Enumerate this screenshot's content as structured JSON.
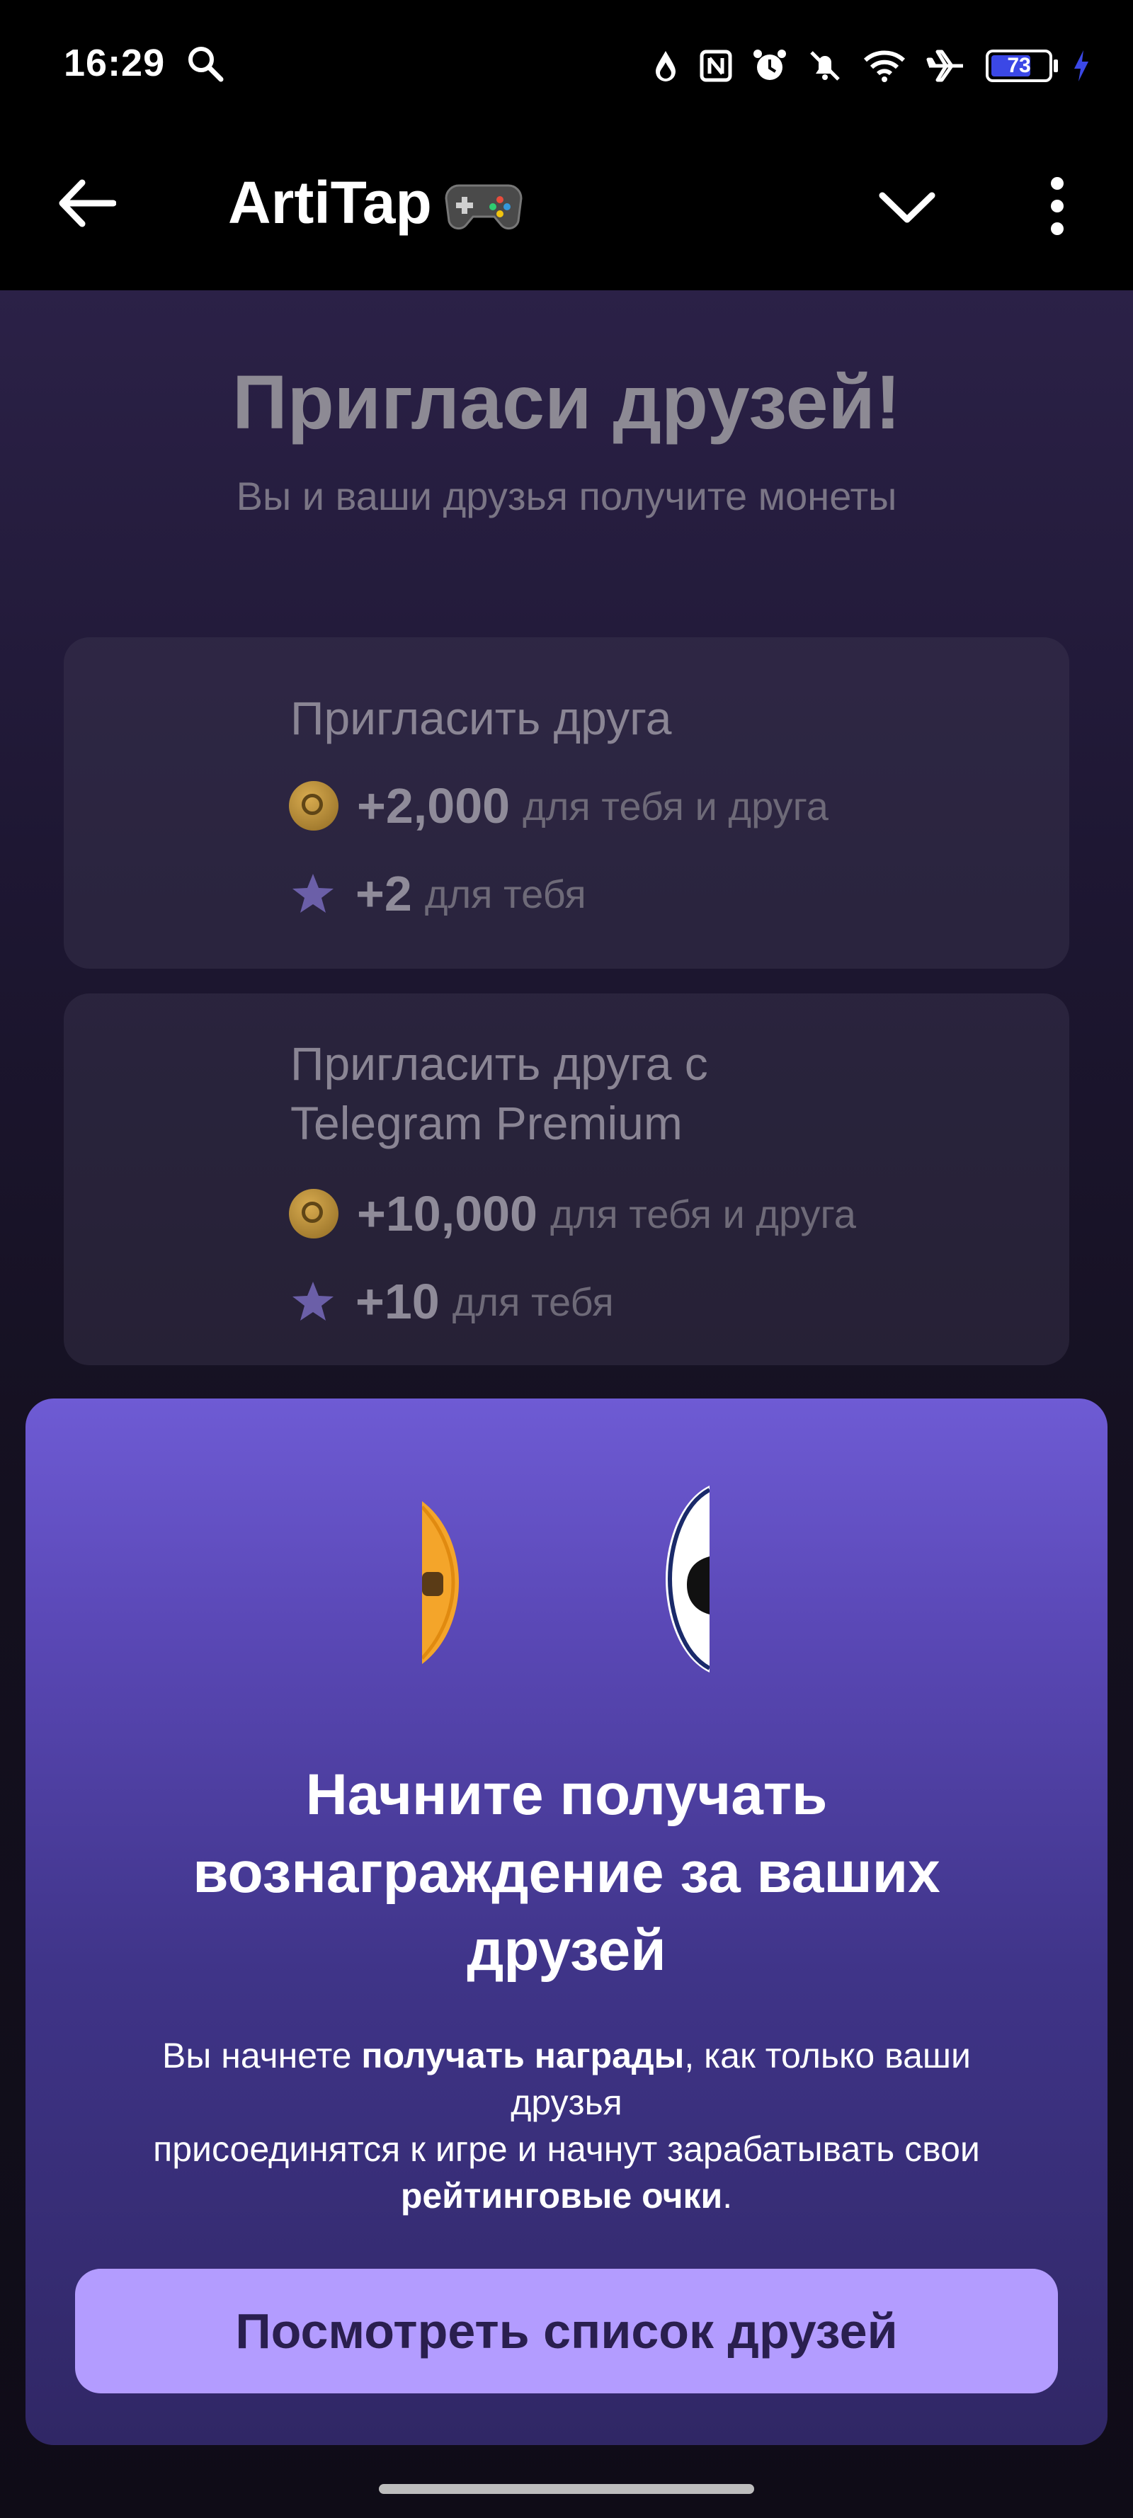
{
  "status_bar": {
    "time": "16:29",
    "battery": "73"
  },
  "header": {
    "title": "ArtiTap",
    "emoji": "🎮"
  },
  "page": {
    "title": "Пригласи друзей!",
    "subtitle": "Вы и ваши друзья получите монеты"
  },
  "cards": [
    {
      "title_lines": [
        "Пригласить друга"
      ],
      "coin_amount": "+2,000",
      "coin_text": "для тебя и друга",
      "star_amount": "+2",
      "star_text": "для тебя"
    },
    {
      "title_lines": [
        "Пригласить друга с",
        "Telegram Premium"
      ],
      "coin_amount": "+10,000",
      "coin_text": "для тебя и друга",
      "star_amount": "+10",
      "star_text": "для тебя"
    }
  ],
  "sheet": {
    "title_lines": [
      "Начните получать",
      "вознаграждение за ваших",
      "друзей"
    ],
    "text_1": "Вы начнете ",
    "text_bold_1": "получать награды",
    "text_2": ", как только ваши",
    "text_3": "друзья",
    "text_4": "присоединятся к игре и начнут зарабатывать свои",
    "text_bold_2": "рейтинговые очки",
    "text_5": ".",
    "button_label": "Посмотреть список друзей"
  },
  "colors": {
    "sheet_top": "#6e5bd4",
    "sheet_bottom": "#302765",
    "button_bg": "#b39cff",
    "coin": "#c9993f",
    "battery_fill": "#3b48e6"
  }
}
